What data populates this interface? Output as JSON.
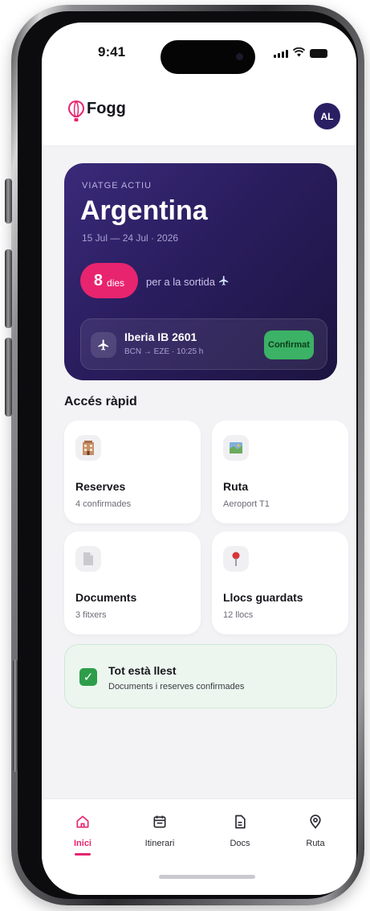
{
  "status_bar": {
    "time": "9:41"
  },
  "header": {
    "app_name": "Fogg",
    "avatar_initials": "AL"
  },
  "trip": {
    "kicker": "VIATGE ACTIU",
    "destination": "Argentina",
    "dates": "15 Jul — 24 Jul · 2026",
    "days_count": "8",
    "days_label": "dies",
    "countdown_note": "per a la sortida",
    "flight": {
      "name": "Iberia IB 2601",
      "details": "BCN → EZE · 10:25 h",
      "status": "Confirmat"
    }
  },
  "quick_access": {
    "title": "Accés ràpid",
    "tiles": [
      {
        "title": "Reserves",
        "subtitle": "4 confirmades",
        "icon": "hotel-icon"
      },
      {
        "title": "Ruta",
        "subtitle": "Aeroport T1",
        "icon": "map-icon"
      },
      {
        "title": "Documents",
        "subtitle": "3 fitxers",
        "icon": "document-icon"
      },
      {
        "title": "Llocs guardats",
        "subtitle": "12 llocs",
        "icon": "pin-icon"
      }
    ]
  },
  "ready_card": {
    "title": "Tot està llest",
    "subtitle": "Documents i reserves confirmades"
  },
  "tabbar": {
    "tabs": [
      {
        "label": "Inici",
        "icon": "home-icon",
        "active": true
      },
      {
        "label": "Itinerari",
        "icon": "calendar-icon",
        "active": false
      },
      {
        "label": "Docs",
        "icon": "document-icon",
        "active": false
      },
      {
        "label": "Ruta",
        "icon": "location-icon",
        "active": false
      }
    ]
  },
  "colors": {
    "accent": "#e8246f",
    "hero_start": "#3a2a7a",
    "hero_end": "#1c1440",
    "confirmed": "#3bb265",
    "ready_bg": "#ecf6ee"
  }
}
